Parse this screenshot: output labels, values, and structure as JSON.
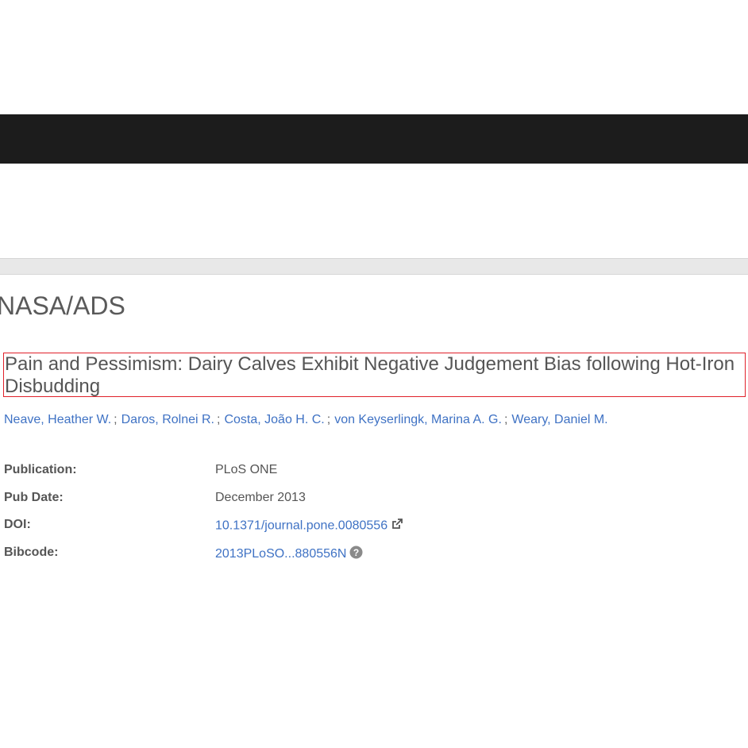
{
  "brand": {
    "name": "NASA/ADS"
  },
  "article": {
    "title": "Pain and Pessimism: Dairy Calves Exhibit Negative Judgement Bias following Hot-Iron Disbudding",
    "authors": [
      "Neave, Heather W.",
      "Daros, Rolnei R.",
      "Costa, João H. C.",
      "von Keyserlingk, Marina A. G.",
      "Weary, Daniel M."
    ],
    "author_separator": ";"
  },
  "metadata": {
    "publication_label": "Publication:",
    "publication_value": "PLoS ONE",
    "pubdate_label": "Pub Date:",
    "pubdate_value": "December 2013",
    "doi_label": "DOI:",
    "doi_value": "10.1371/journal.pone.0080556",
    "bibcode_label": "Bibcode:",
    "bibcode_value": "2013PLoSO...880556N"
  },
  "icons": {
    "doi_link_icon": "external-link-icon",
    "bibcode_help_icon": "question-circle-icon"
  },
  "colors": {
    "link": "#3f72c4",
    "topbar": "#1c1c1c",
    "highlight_border": "#e0202a"
  }
}
